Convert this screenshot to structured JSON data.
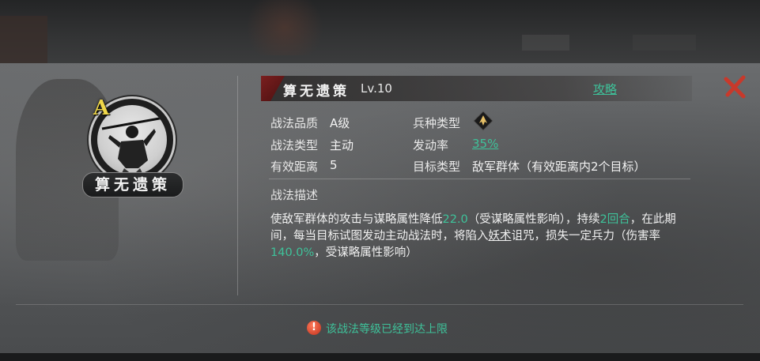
{
  "skill": {
    "grade": "A",
    "name": "算无遗策",
    "level": "Lv.10",
    "guide_link": "攻略"
  },
  "attributes": {
    "quality_label": "战法品质",
    "quality_value": "A级",
    "troop_label": "兵种类型",
    "troop_icon": "troop-type-icon",
    "type_label": "战法类型",
    "type_value": "主动",
    "trigger_label": "发动率",
    "trigger_value": "35%",
    "range_label": "有效距离",
    "range_value": "5",
    "target_label": "目标类型",
    "target_value": "敌军群体（有效距离内2个目标）"
  },
  "description": {
    "title": "战法描述",
    "p1": "使敌军群体的攻击与谋略属性降低",
    "v1": "22.0",
    "p2": "（受谋略属性影响），持续",
    "v2": "2回合",
    "p3": "，在此期间，每当目标试图发动主动战法时，将陷入",
    "link": "妖术",
    "p4": "诅咒，损失一定兵力（伤害率",
    "v3": "140.0%",
    "p5": "，受谋略属性影响）"
  },
  "notice": {
    "icon": "warning-icon",
    "text": "该战法等级已经到达上限"
  },
  "colors": {
    "accent_green": "#3ec29a",
    "grade_yellow": "#f0d84a",
    "close_red": "#c8392b"
  }
}
